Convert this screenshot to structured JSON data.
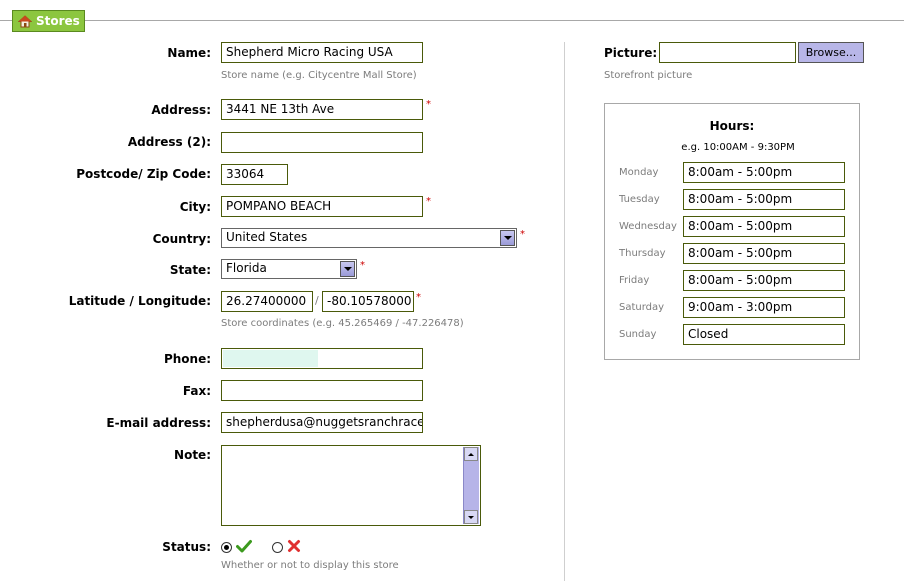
{
  "section_tab": {
    "label": "Stores",
    "icon": "home-icon"
  },
  "form": {
    "name": {
      "label": "Name:",
      "value": "Shepherd Micro Racing USA",
      "hint": "Store name (e.g. Citycentre Mall Store)"
    },
    "address": {
      "label": "Address:",
      "value": "3441 NE 13th Ave",
      "required": "*"
    },
    "address2": {
      "label": "Address (2):",
      "value": ""
    },
    "postcode": {
      "label": "Postcode/ Zip Code:",
      "value": "33064"
    },
    "city": {
      "label": "City:",
      "value": "POMPANO BEACH",
      "required": "*"
    },
    "country": {
      "label": "Country:",
      "value": "United States",
      "required": "*"
    },
    "state": {
      "label": "State:",
      "value": "Florida",
      "required": "*"
    },
    "latlng": {
      "label": "Latitude / Longitude:",
      "lat": "26.27400000",
      "separator": "/",
      "lng": "-80.10578000",
      "required": "*",
      "hint": "Store coordinates (e.g. 45.265469 / -47.226478)"
    },
    "phone": {
      "label": "Phone:",
      "value": ""
    },
    "fax": {
      "label": "Fax:",
      "value": ""
    },
    "email": {
      "label": "E-mail address:",
      "value": "shepherdusa@nuggetsranchracew"
    },
    "note": {
      "label": "Note:",
      "value": ""
    },
    "status": {
      "label": "Status:",
      "selected": "enabled",
      "hint": "Whether or not to display this store"
    }
  },
  "picture": {
    "label": "Picture:",
    "value": "",
    "browse_label": "Browse...",
    "hint": "Storefront picture"
  },
  "hours": {
    "title": "Hours:",
    "example": "e.g. 10:00AM - 9:30PM",
    "days": [
      {
        "day": "Monday",
        "value": "8:00am - 5:00pm"
      },
      {
        "day": "Tuesday",
        "value": "8:00am - 5:00pm"
      },
      {
        "day": "Wednesday",
        "value": "8:00am - 5:00pm"
      },
      {
        "day": "Thursday",
        "value": "8:00am - 5:00pm"
      },
      {
        "day": "Friday",
        "value": "8:00am - 5:00pm"
      },
      {
        "day": "Saturday",
        "value": "9:00am - 3:00pm"
      },
      {
        "day": "Sunday",
        "value": "Closed"
      }
    ]
  },
  "colors": {
    "tab_bg": "#8cc63f",
    "input_border": "#4a5a0a",
    "required": "#cc0000",
    "hint": "#7c7c7c",
    "scroll": "#b6b4e8"
  }
}
